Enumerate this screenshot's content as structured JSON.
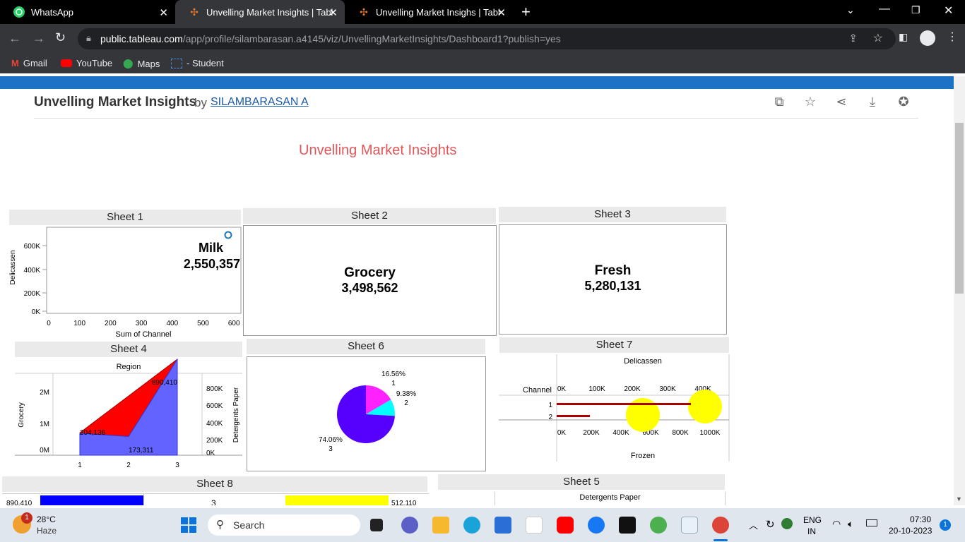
{
  "browser": {
    "tabs": [
      {
        "label": "WhatsApp"
      },
      {
        "label": "Unvelling Market Insights | Table"
      },
      {
        "label": "Unvelling Market Insighs | Table"
      }
    ],
    "url_host": "public.tableau.com",
    "url_path": "/app/profile/silambarasan.a4145/viz/UnvellingMarketInsights/Dashboard1?publish=yes",
    "bookmarks": [
      {
        "label": "Gmail"
      },
      {
        "label": "YouTube"
      },
      {
        "label": "Maps"
      },
      {
        "label": "- Student"
      }
    ]
  },
  "viz": {
    "title": "Unvelling Market Insights",
    "by": "by",
    "author": "SILAMBARASAN A",
    "dashboard_title": "Unvelling Market Insights"
  },
  "sheets": {
    "s1": {
      "title": "Sheet 1",
      "label": "Milk",
      "value": "2,550,357",
      "ylabel": "Delicassen",
      "xlabel": "Sum of Channel",
      "yticks": [
        "600K",
        "400K",
        "200K",
        "0K"
      ],
      "xticks": [
        "0",
        "100",
        "200",
        "300",
        "400",
        "500",
        "600"
      ]
    },
    "s2": {
      "title": "Sheet 2",
      "label": "Grocery",
      "value": "3,498,562"
    },
    "s3": {
      "title": "Sheet 3",
      "label": "Fresh",
      "value": "5,280,131"
    },
    "s4": {
      "title": "Sheet 4",
      "header": "Region",
      "ylabel": "Grocery",
      "ylabel2": "Detergents Paper",
      "yticks_left": [
        "2M",
        "1M",
        "0M"
      ],
      "yticks_right": [
        "800K",
        "600K",
        "400K",
        "200K",
        "0K"
      ],
      "xticks": [
        "1",
        "2",
        "3"
      ],
      "labels": [
        "890,410",
        "204,136",
        "173,311"
      ]
    },
    "s6": {
      "title": "Sheet 6",
      "slices": [
        {
          "pct": "16.56%",
          "cat": "1"
        },
        {
          "pct": "9.38%",
          "cat": "2"
        },
        {
          "pct": "74.06%",
          "cat": "3"
        }
      ]
    },
    "s7": {
      "title": "Sheet 7",
      "top_label": "Delicassen",
      "bottom_label": "Frozen",
      "row_header": "Channel",
      "rows": [
        "1",
        "2"
      ],
      "top_ticks": [
        "0K",
        "100K",
        "200K",
        "300K",
        "400K"
      ],
      "bottom_ticks": [
        "0K",
        "200K",
        "400K",
        "600K",
        "800K",
        "1000K"
      ]
    },
    "s8": {
      "title": "Sheet 8",
      "left_value": "890,410",
      "mid_label": "3",
      "right_value": "512,110"
    },
    "s5": {
      "title": "Sheet 5",
      "top_label": "Detergents Paper"
    }
  },
  "chart_data": [
    {
      "type": "scatter",
      "title": "Sheet 1",
      "xlabel": "Sum of Channel",
      "ylabel": "Delicassen",
      "xlim": [
        0,
        600
      ],
      "ylim": [
        0,
        700000
      ],
      "series": [
        {
          "name": "Milk",
          "x": [
            584
          ],
          "y": [
            670000
          ]
        }
      ]
    },
    {
      "type": "area",
      "title": "Sheet 4",
      "categories": [
        "1",
        "2",
        "3"
      ],
      "series": [
        {
          "name": "Grocery",
          "values": [
            570000,
            570000,
            2440000
          ]
        },
        {
          "name": "Detergents Paper",
          "values": [
            204136,
            173311,
            890410
          ]
        }
      ]
    },
    {
      "type": "pie",
      "title": "Sheet 6",
      "categories": [
        "1",
        "2",
        "3"
      ],
      "values": [
        16.56,
        9.38,
        74.06
      ]
    }
  ],
  "taskbar": {
    "weather_temp": "28°C",
    "weather_desc": "Haze",
    "search_placeholder": "Search",
    "lang1": "ENG",
    "lang2": "IN",
    "time": "07:30",
    "date": "20-10-2023",
    "notif_count": "1",
    "weather_badge": "1"
  }
}
